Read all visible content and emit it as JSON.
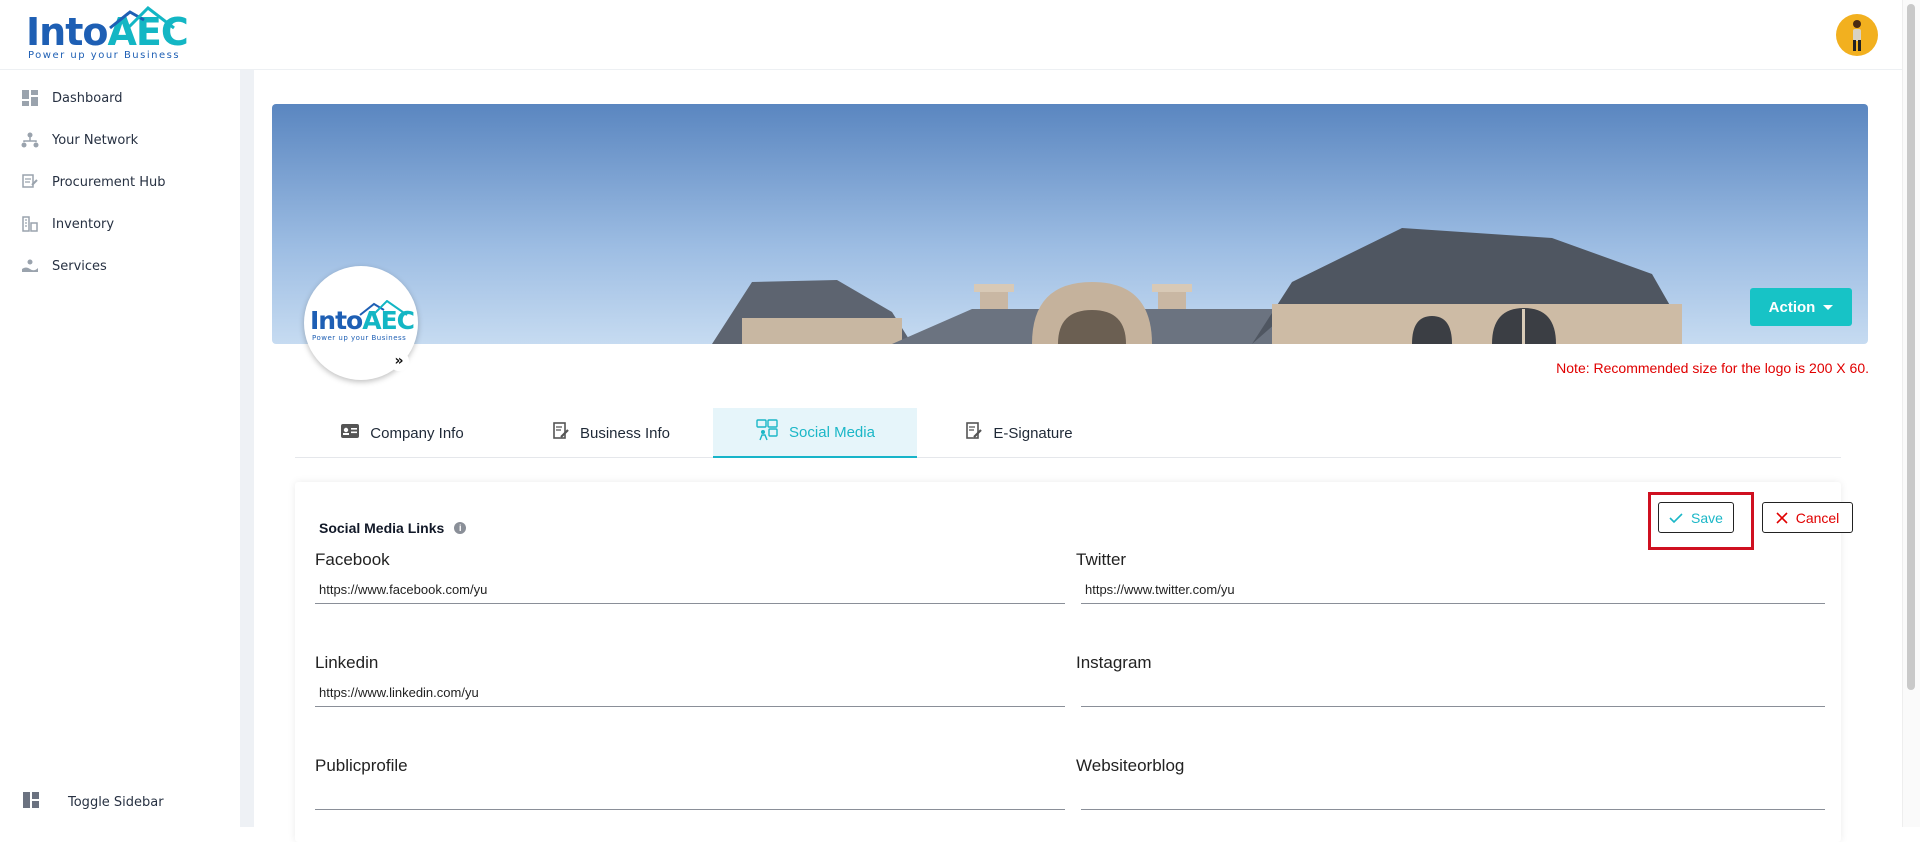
{
  "brand": {
    "name_part1": "Into",
    "name_part2": "AEC",
    "tagline": "Power up your Business"
  },
  "header": {
    "avatar_icon": "user-avatar-icon"
  },
  "sidebar": {
    "items": [
      {
        "label": "Dashboard",
        "icon": "dashboard-icon"
      },
      {
        "label": "Your Network",
        "icon": "network-icon"
      },
      {
        "label": "Procurement Hub",
        "icon": "procurement-icon"
      },
      {
        "label": "Inventory",
        "icon": "inventory-icon"
      },
      {
        "label": "Services",
        "icon": "services-icon"
      }
    ],
    "toggle_label": "Toggle Sidebar"
  },
  "profile": {
    "action_label": "Action",
    "expand_glyph": "»",
    "note": "Note: Recommended size for the logo is 200 X 60."
  },
  "tabs": [
    {
      "label": "Company Info",
      "icon": "id-card-icon",
      "active": false
    },
    {
      "label": "Business Info",
      "icon": "edit-document-icon",
      "active": false
    },
    {
      "label": "Social Media",
      "icon": "social-media-icon",
      "active": true
    },
    {
      "label": "E-Signature",
      "icon": "signature-icon",
      "active": false
    }
  ],
  "social": {
    "title": "Social Media Links",
    "save_label": "Save",
    "cancel_label": "Cancel",
    "fields": {
      "facebook": {
        "label": "Facebook",
        "value": "https://www.facebook.com/yu"
      },
      "twitter": {
        "label": "Twitter",
        "value": "https://www.twitter.com/yu"
      },
      "linkedin": {
        "label": "Linkedin",
        "value": "https://www.linkedin.com/yu"
      },
      "instagram": {
        "label": "Instagram",
        "value": ""
      },
      "publicprofile": {
        "label": "Publicprofile",
        "value": ""
      },
      "websiteorblog": {
        "label": "Websiteorblog",
        "value": ""
      }
    }
  },
  "colors": {
    "accent": "#17c3c6",
    "brand_blue": "#1e5fb4",
    "danger": "#e00000",
    "highlight": "#cf1020"
  }
}
